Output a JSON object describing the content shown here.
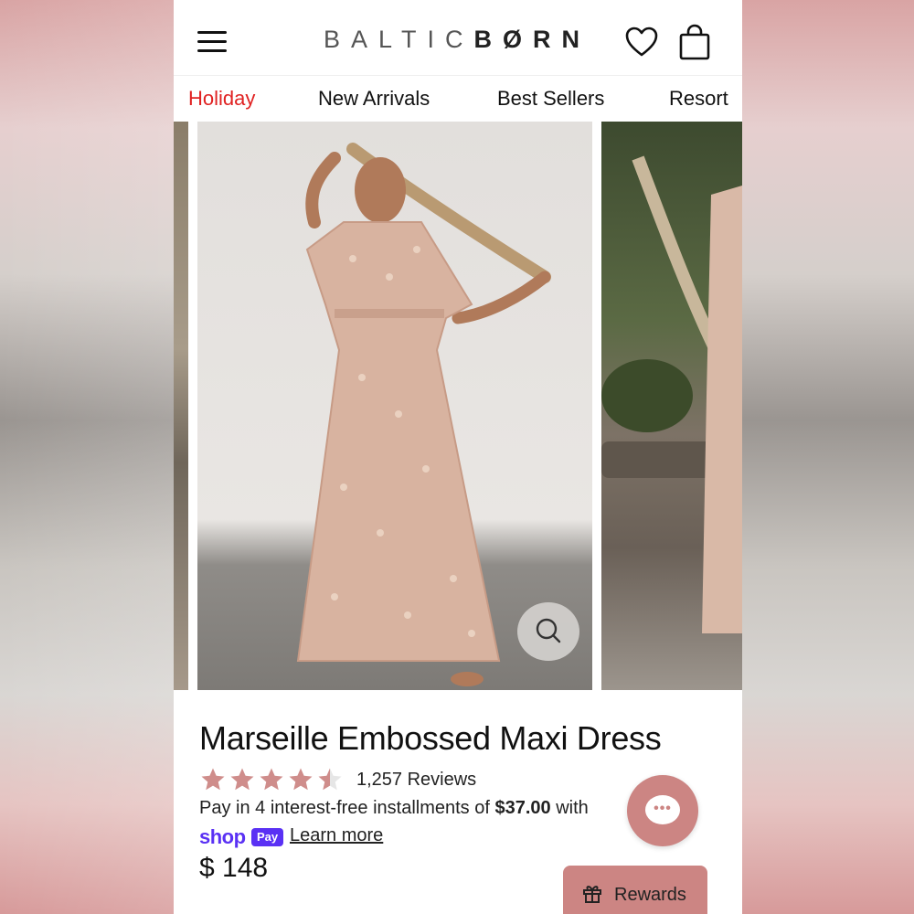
{
  "header": {
    "logo_left": "BALTIC",
    "logo_right": "BØRN"
  },
  "nav": {
    "items": [
      {
        "label": "Holiday",
        "color": "#e02222"
      },
      {
        "label": "New Arrivals"
      },
      {
        "label": "Best Sellers"
      },
      {
        "label": "Resort"
      }
    ]
  },
  "product": {
    "title": "Marseille Embossed Maxi Dress",
    "rating": 4.5,
    "reviews": "1,257 Reviews",
    "installments_prefix": "Pay in 4 interest-free installments of ",
    "installments_amount": "$37.00",
    "installments_suffix": " with",
    "shoppay_word": "shop",
    "shoppay_pill": "Pay",
    "learn_more": "Learn more",
    "price": "$ 148"
  },
  "rewards": {
    "label": "Rewards"
  },
  "colors": {
    "accent": "#cc8583",
    "holiday": "#e02222",
    "shoppay": "#5a31f4",
    "star": "#cf8d8b"
  },
  "icons": [
    "menu-icon",
    "heart-icon",
    "bag-icon",
    "search-icon",
    "chat-icon",
    "gift-icon",
    "star-icon"
  ]
}
